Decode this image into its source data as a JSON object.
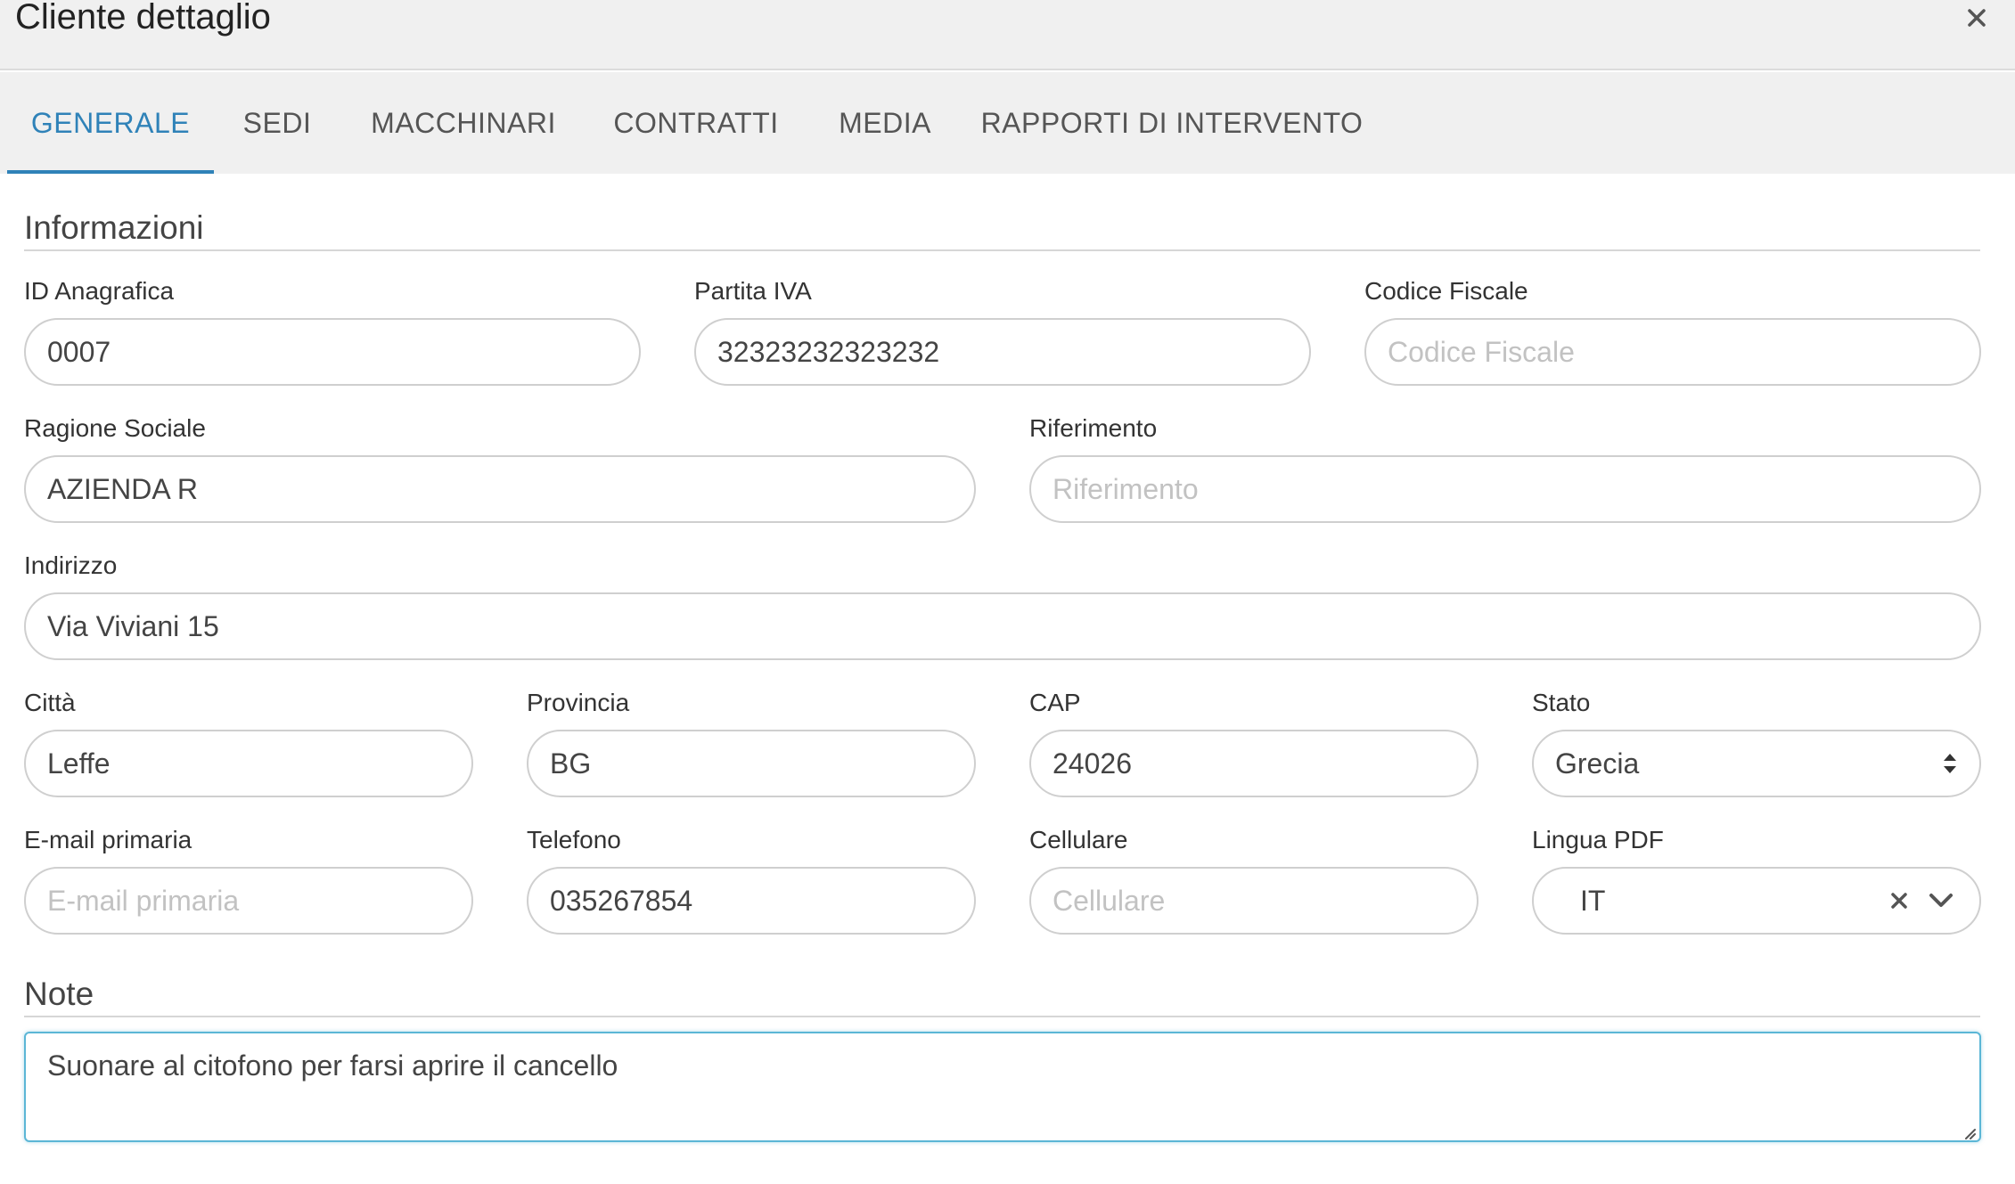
{
  "header": {
    "title": "Cliente dettaglio",
    "close_icon": "close-icon"
  },
  "tabs": [
    {
      "label": "GENERALE",
      "active": true
    },
    {
      "label": "SEDI",
      "active": false
    },
    {
      "label": "MACCHINARI",
      "active": false
    },
    {
      "label": "CONTRATTI",
      "active": false
    },
    {
      "label": "MEDIA",
      "active": false
    },
    {
      "label": "RAPPORTI DI INTERVENTO",
      "active": false
    }
  ],
  "colors": {
    "accent": "#2f82b8",
    "focus": "#5bb6d6",
    "header_bg": "#f0f0f0"
  },
  "informazioni": {
    "heading": "Informazioni",
    "id_anagrafica": {
      "label": "ID Anagrafica",
      "value": "0007",
      "placeholder": "ID Anagrafica"
    },
    "partita_iva": {
      "label": "Partita IVA",
      "value": "32323232323232",
      "placeholder": "Partita IVA"
    },
    "codice_fiscale": {
      "label": "Codice Fiscale",
      "value": "",
      "placeholder": "Codice Fiscale"
    },
    "ragione_sociale": {
      "label": "Ragione Sociale",
      "value": "AZIENDA R",
      "placeholder": "Ragione Sociale"
    },
    "riferimento": {
      "label": "Riferimento",
      "value": "",
      "placeholder": "Riferimento"
    },
    "indirizzo": {
      "label": "Indirizzo",
      "value": "Via Viviani 15",
      "placeholder": "Indirizzo"
    },
    "citta": {
      "label": "Città",
      "value": "Leffe",
      "placeholder": "Città"
    },
    "provincia": {
      "label": "Provincia",
      "value": "BG",
      "placeholder": "Provincia"
    },
    "cap": {
      "label": "CAP",
      "value": "24026",
      "placeholder": "CAP"
    },
    "stato": {
      "label": "Stato",
      "value": "Grecia",
      "icon": "sort-arrows-icon"
    },
    "email": {
      "label": "E-mail primaria",
      "value": "",
      "placeholder": "E-mail primaria"
    },
    "telefono": {
      "label": "Telefono",
      "value": "035267854",
      "placeholder": "Telefono"
    },
    "cellulare": {
      "label": "Cellulare",
      "value": "",
      "placeholder": "Cellulare"
    },
    "lingua_pdf": {
      "label": "Lingua PDF",
      "value": "IT",
      "clear_icon": "clear-icon",
      "chevron_icon": "chevron-down-icon"
    }
  },
  "note": {
    "heading": "Note",
    "value": "Suonare al citofono per farsi aprire il cancello"
  }
}
